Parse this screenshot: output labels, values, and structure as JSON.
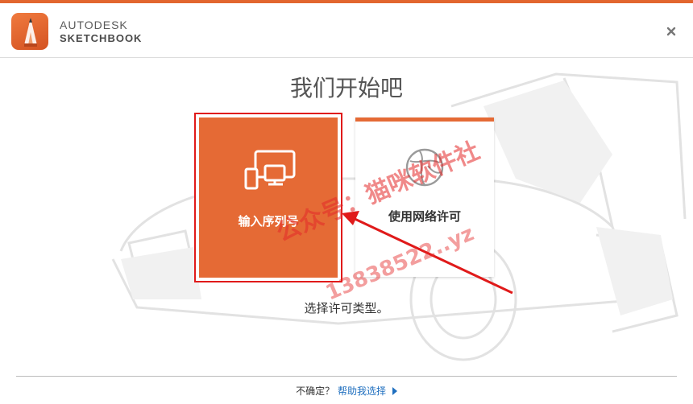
{
  "app": {
    "brand_line1": "AUTODESK",
    "brand_line2": "SKETCHBOOK",
    "logo_icon": "pencil-logo-icon",
    "close_icon": "close-icon"
  },
  "main": {
    "title": "我们开始吧",
    "subtitle": "选择许可类型。"
  },
  "options": [
    {
      "label": "输入序列号",
      "icon": "devices-icon",
      "selected": true
    },
    {
      "label": "使用网络许可",
      "icon": "network-globe-icon",
      "selected": false
    }
  ],
  "footer": {
    "question": "不确定？",
    "help_link": "帮助我选择"
  },
  "watermark": {
    "line1": "公众号：猫咪软件社",
    "line2": "13838522..yz"
  },
  "colors": {
    "accent": "#e56a35",
    "highlight_border": "#e01a1a",
    "link": "#1f6fbf"
  }
}
